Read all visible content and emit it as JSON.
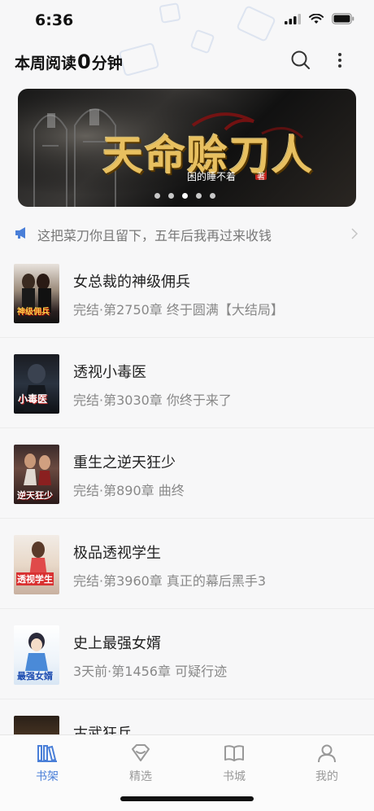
{
  "status_bar": {
    "time": "6:36"
  },
  "header": {
    "reading_prefix": "本周阅读",
    "reading_minutes": "0",
    "reading_suffix": "分钟",
    "search_icon": "search-icon",
    "more_icon": "more-vertical-icon"
  },
  "banner": {
    "title": "天命赊刀人",
    "author": "困的睡不着",
    "author_badge": "著",
    "dots": 5,
    "active_dot": 2
  },
  "notice": {
    "text": "这把菜刀你且留下，五年后我再过来收钱"
  },
  "books": [
    {
      "title": "女总裁的神级佣兵",
      "status": "完结·第2750章 终于圆满【大结局】",
      "cover_text": "神级佣兵"
    },
    {
      "title": "透视小毒医",
      "status": "完结·第3030章 你终于来了",
      "cover_text": "小毒医"
    },
    {
      "title": "重生之逆天狂少",
      "status": "完结·第890章 曲终",
      "cover_text": "逆天狂少"
    },
    {
      "title": "极品透视学生",
      "status": "完结·第3960章 真正的幕后黑手3",
      "cover_text": "透视学生"
    },
    {
      "title": "史上最强女婿",
      "status": "3天前·第1456章  可疑行迹",
      "cover_text": "最强女婿"
    },
    {
      "title": "古武狂兵",
      "status": "",
      "cover_text": ""
    }
  ],
  "tabs": [
    {
      "label": "书架",
      "icon": "bookshelf-icon",
      "active": true
    },
    {
      "label": "精选",
      "icon": "diamond-icon",
      "active": false
    },
    {
      "label": "书城",
      "icon": "open-book-icon",
      "active": false
    },
    {
      "label": "我的",
      "icon": "person-icon",
      "active": false
    }
  ],
  "colors": {
    "accent": "#4a7fd8",
    "background": "#f7f7f8",
    "text_primary": "#222222",
    "text_secondary": "#888888"
  }
}
